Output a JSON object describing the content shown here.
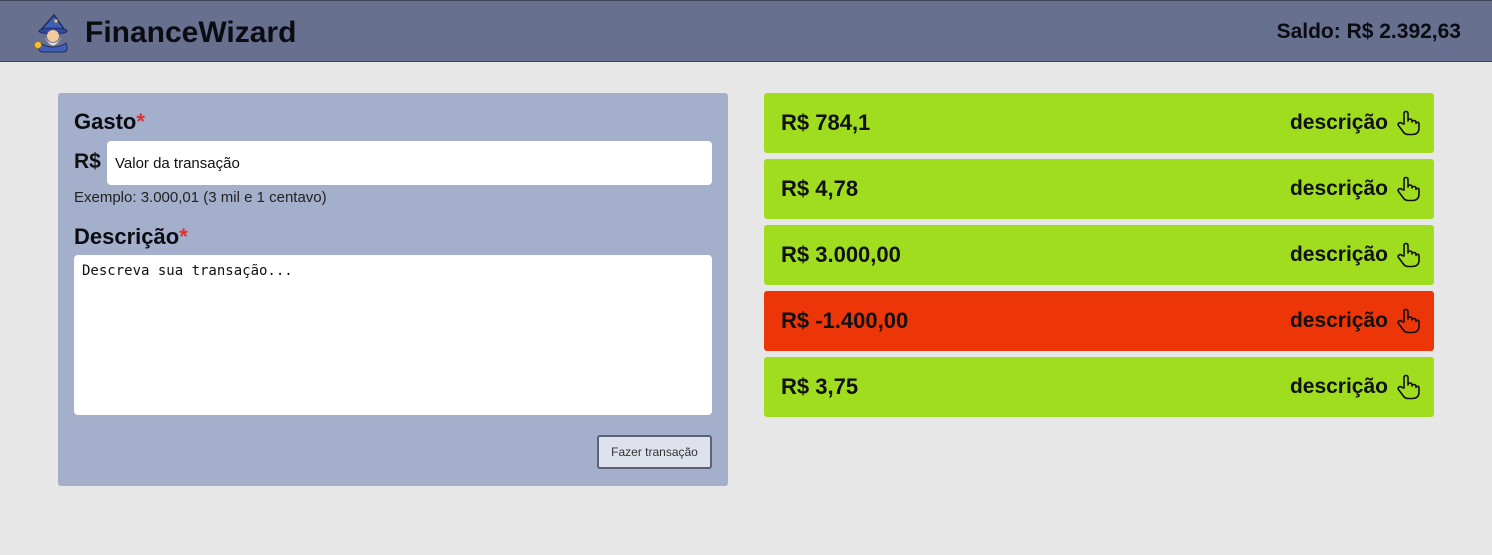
{
  "header": {
    "app_title": "FinanceWizard",
    "logo_icon": "wizard-icon",
    "balance_text": "Saldo: R$ 2.392,63"
  },
  "form": {
    "title_label": "Gasto",
    "required_mark": "*",
    "currency_prefix": "R$",
    "value_placeholder": "Valor da transação",
    "hint": "Exemplo: 3.000,01 (3 mil e 1 centavo)",
    "description_label": "Descrição",
    "description_placeholder": "Descreva sua transação...",
    "submit_label": "Fazer transação"
  },
  "colors": {
    "income": "#9fdd1e",
    "expense": "#ec3608",
    "header": "#67718f",
    "panel": "#a4afcb"
  },
  "transactions": [
    {
      "amount": "R$ 784,1",
      "desc_label": "descrição",
      "type": "income",
      "icon": "pointing-hand-icon"
    },
    {
      "amount": "R$ 4,78",
      "desc_label": "descrição",
      "type": "income",
      "icon": "pointing-hand-icon"
    },
    {
      "amount": "R$ 3.000,00",
      "desc_label": "descrição",
      "type": "income",
      "icon": "pointing-hand-icon"
    },
    {
      "amount": "R$ -1.400,00",
      "desc_label": "descrição",
      "type": "expense",
      "icon": "pointing-hand-icon"
    },
    {
      "amount": "R$ 3,75",
      "desc_label": "descrição",
      "type": "income",
      "icon": "pointing-hand-icon"
    }
  ]
}
